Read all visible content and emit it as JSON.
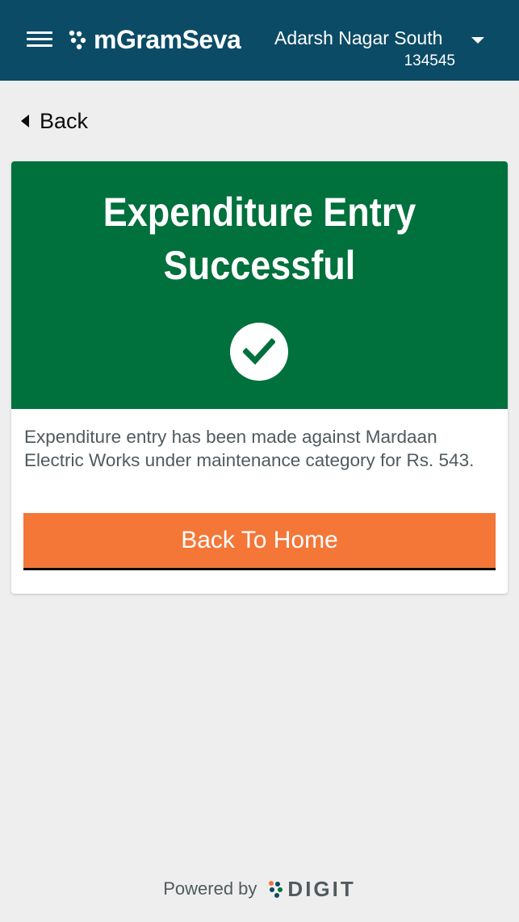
{
  "header": {
    "brand": "mGramSeva",
    "location_name": "Adarsh Nagar South",
    "location_code": "134545"
  },
  "nav": {
    "back_label": "Back"
  },
  "card": {
    "title": "Expenditure Entry Successful",
    "message": "Expenditure entry has been made against Mardaan Electric Works under maintenance category for Rs. 543.",
    "button_label": "Back To Home"
  },
  "footer": {
    "powered_by": "Powered by",
    "digit_label": "DIGIT"
  },
  "colors": {
    "header_bg": "#0b4b66",
    "success_bg": "#00703c",
    "primary_button": "#f47738",
    "page_bg": "#eeeeee"
  },
  "icons": [
    "hamburger-menu-icon",
    "brand-logo-icon",
    "chevron-down-icon",
    "back-arrow-icon",
    "checkmark-circle-icon",
    "digit-logo-icon"
  ]
}
